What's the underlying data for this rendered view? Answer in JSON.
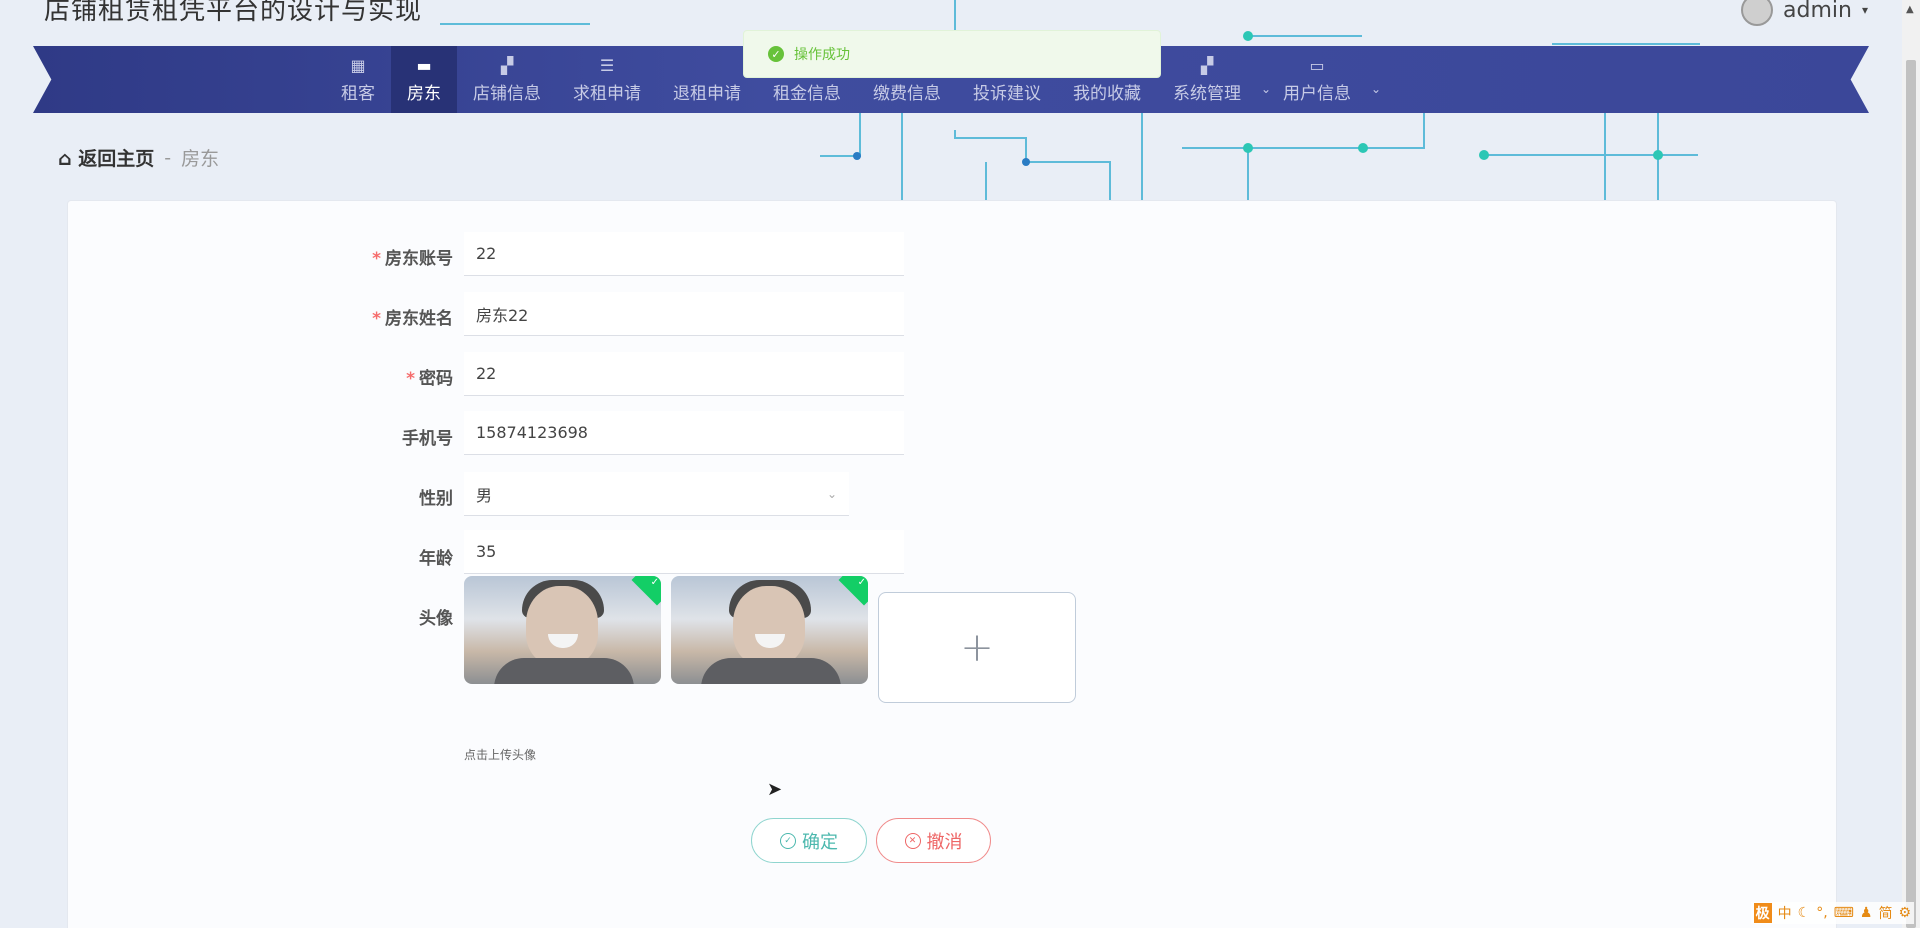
{
  "app": {
    "title": "店铺租赁租凭平台的设计与实现",
    "user": "admin"
  },
  "nav": {
    "items": [
      {
        "label": "租客",
        "icon": "grid-icon"
      },
      {
        "label": "房东",
        "icon": "brush-icon"
      },
      {
        "label": "店铺信息",
        "icon": "apps-icon"
      },
      {
        "label": "求租申请",
        "icon": "sliders-icon"
      },
      {
        "label": "退租申请",
        "icon": ""
      },
      {
        "label": "租金信息",
        "icon": ""
      },
      {
        "label": "缴费信息",
        "icon": ""
      },
      {
        "label": "投诉建议",
        "icon": ""
      },
      {
        "label": "我的收藏",
        "icon": "user-icon"
      },
      {
        "label": "系统管理",
        "icon": "apps-icon"
      },
      {
        "label": "用户信息",
        "icon": "card-icon"
      }
    ],
    "active": "房东"
  },
  "toast": {
    "message": "操作成功"
  },
  "breadcrumb": {
    "home": "返回主页",
    "separator": "-",
    "current": "房东"
  },
  "form": {
    "account": {
      "label": "房东账号",
      "value": "22",
      "required": true
    },
    "name": {
      "label": "房东姓名",
      "value": "房东22",
      "required": true
    },
    "password": {
      "label": "密码",
      "value": "22",
      "required": true
    },
    "phone": {
      "label": "手机号",
      "value": "15874123698"
    },
    "gender": {
      "label": "性别",
      "value": "男"
    },
    "age": {
      "label": "年龄",
      "value": "35"
    },
    "avatar": {
      "label": "头像",
      "tip": "点击上传头像",
      "images": 2
    }
  },
  "buttons": {
    "confirm": "确定",
    "cancel": "撤消"
  },
  "ime": {
    "items": [
      "中",
      "简"
    ]
  },
  "colors": {
    "nav_bg": "#3b4799",
    "nav_active": "#283276",
    "toast_green": "#67c23a",
    "required": "#f56c6c",
    "confirm": "#4cb8ae",
    "cancel": "#ee6666"
  }
}
